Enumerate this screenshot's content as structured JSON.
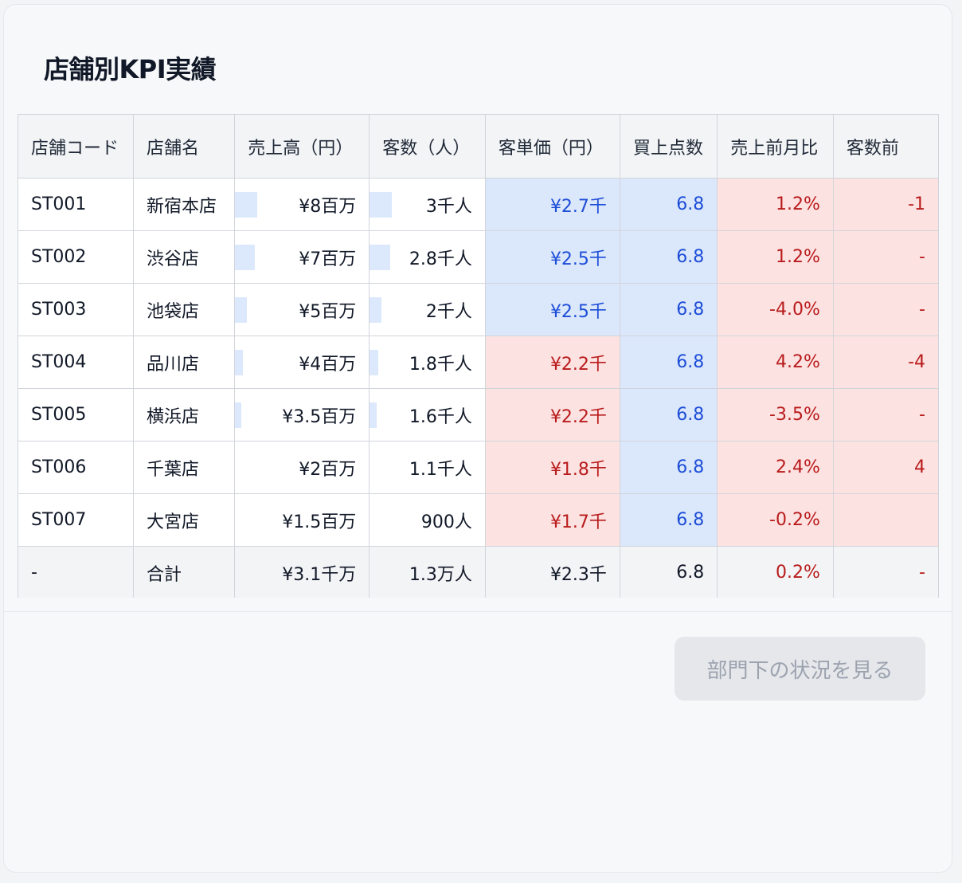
{
  "title": "店舗別KPI実績",
  "columns": [
    "店舗コード",
    "店舗名",
    "売上高（円）",
    "客数（人）",
    "客単価（円）",
    "買上点数",
    "売上前月比",
    "客数前"
  ],
  "rows": [
    {
      "code": "ST001",
      "name": "新宿本店",
      "sales": "¥8百万",
      "sales_ratio": 1.0,
      "customers": "3千人",
      "customers_ratio": 1.0,
      "avg": "¥2.7千",
      "avg_state": "pos",
      "items": "6.8",
      "items_state": "pos",
      "mom": "1.2%",
      "mom_state": "neg",
      "cust_mom": "-1",
      "cust_mom_state": "neg"
    },
    {
      "code": "ST002",
      "name": "渋谷店",
      "sales": "¥7百万",
      "sales_ratio": 0.86,
      "customers": "2.8千人",
      "customers_ratio": 0.9,
      "avg": "¥2.5千",
      "avg_state": "pos",
      "items": "6.8",
      "items_state": "pos",
      "mom": "1.2%",
      "mom_state": "neg",
      "cust_mom": "-",
      "cust_mom_state": "neg"
    },
    {
      "code": "ST003",
      "name": "池袋店",
      "sales": "¥5百万",
      "sales_ratio": 0.45,
      "customers": "2千人",
      "customers_ratio": 0.45,
      "avg": "¥2.5千",
      "avg_state": "pos",
      "items": "6.8",
      "items_state": "pos",
      "mom": "-4.0%",
      "mom_state": "neg",
      "cust_mom": "-",
      "cust_mom_state": "neg"
    },
    {
      "code": "ST004",
      "name": "品川店",
      "sales": "¥4百万",
      "sales_ratio": 0.25,
      "customers": "1.8千人",
      "customers_ratio": 0.3,
      "avg": "¥2.2千",
      "avg_state": "neg",
      "items": "6.8",
      "items_state": "pos",
      "mom": "4.2%",
      "mom_state": "neg",
      "cust_mom": "-4",
      "cust_mom_state": "neg"
    },
    {
      "code": "ST005",
      "name": "横浜店",
      "sales": "¥3.5百万",
      "sales_ratio": 0.17,
      "customers": "1.6千人",
      "customers_ratio": 0.2,
      "avg": "¥2.2千",
      "avg_state": "neg",
      "items": "6.8",
      "items_state": "pos",
      "mom": "-3.5%",
      "mom_state": "neg",
      "cust_mom": "-",
      "cust_mom_state": "neg"
    },
    {
      "code": "ST006",
      "name": "千葉店",
      "sales": "¥2百万",
      "sales_ratio": 0.0,
      "customers": "1.1千人",
      "customers_ratio": 0.0,
      "avg": "¥1.8千",
      "avg_state": "neg",
      "items": "6.8",
      "items_state": "pos",
      "mom": "2.4%",
      "mom_state": "neg",
      "cust_mom": "4",
      "cust_mom_state": "neg"
    },
    {
      "code": "ST007",
      "name": "大宮店",
      "sales": "¥1.5百万",
      "sales_ratio": 0.0,
      "customers": "900人",
      "customers_ratio": 0.0,
      "avg": "¥1.7千",
      "avg_state": "neg",
      "items": "6.8",
      "items_state": "pos",
      "mom": "-0.2%",
      "mom_state": "neg",
      "cust_mom": "",
      "cust_mom_state": "neg"
    }
  ],
  "total": {
    "code": "-",
    "name": "合計",
    "sales": "¥3.1千万",
    "customers": "1.3万人",
    "avg": "¥2.3千",
    "items": "6.8",
    "mom": "0.2%",
    "mom_state": "neg",
    "cust_mom": "-",
    "cust_mom_state": "neg"
  },
  "colors": {
    "positive_bg": "#dbe7fb",
    "positive_text": "#1d4ed8",
    "negative_bg": "#fde2e2",
    "negative_text": "#b91c1c",
    "bar": "#dce8fb"
  },
  "footer": {
    "button_label": "部門下の状況を見る"
  }
}
